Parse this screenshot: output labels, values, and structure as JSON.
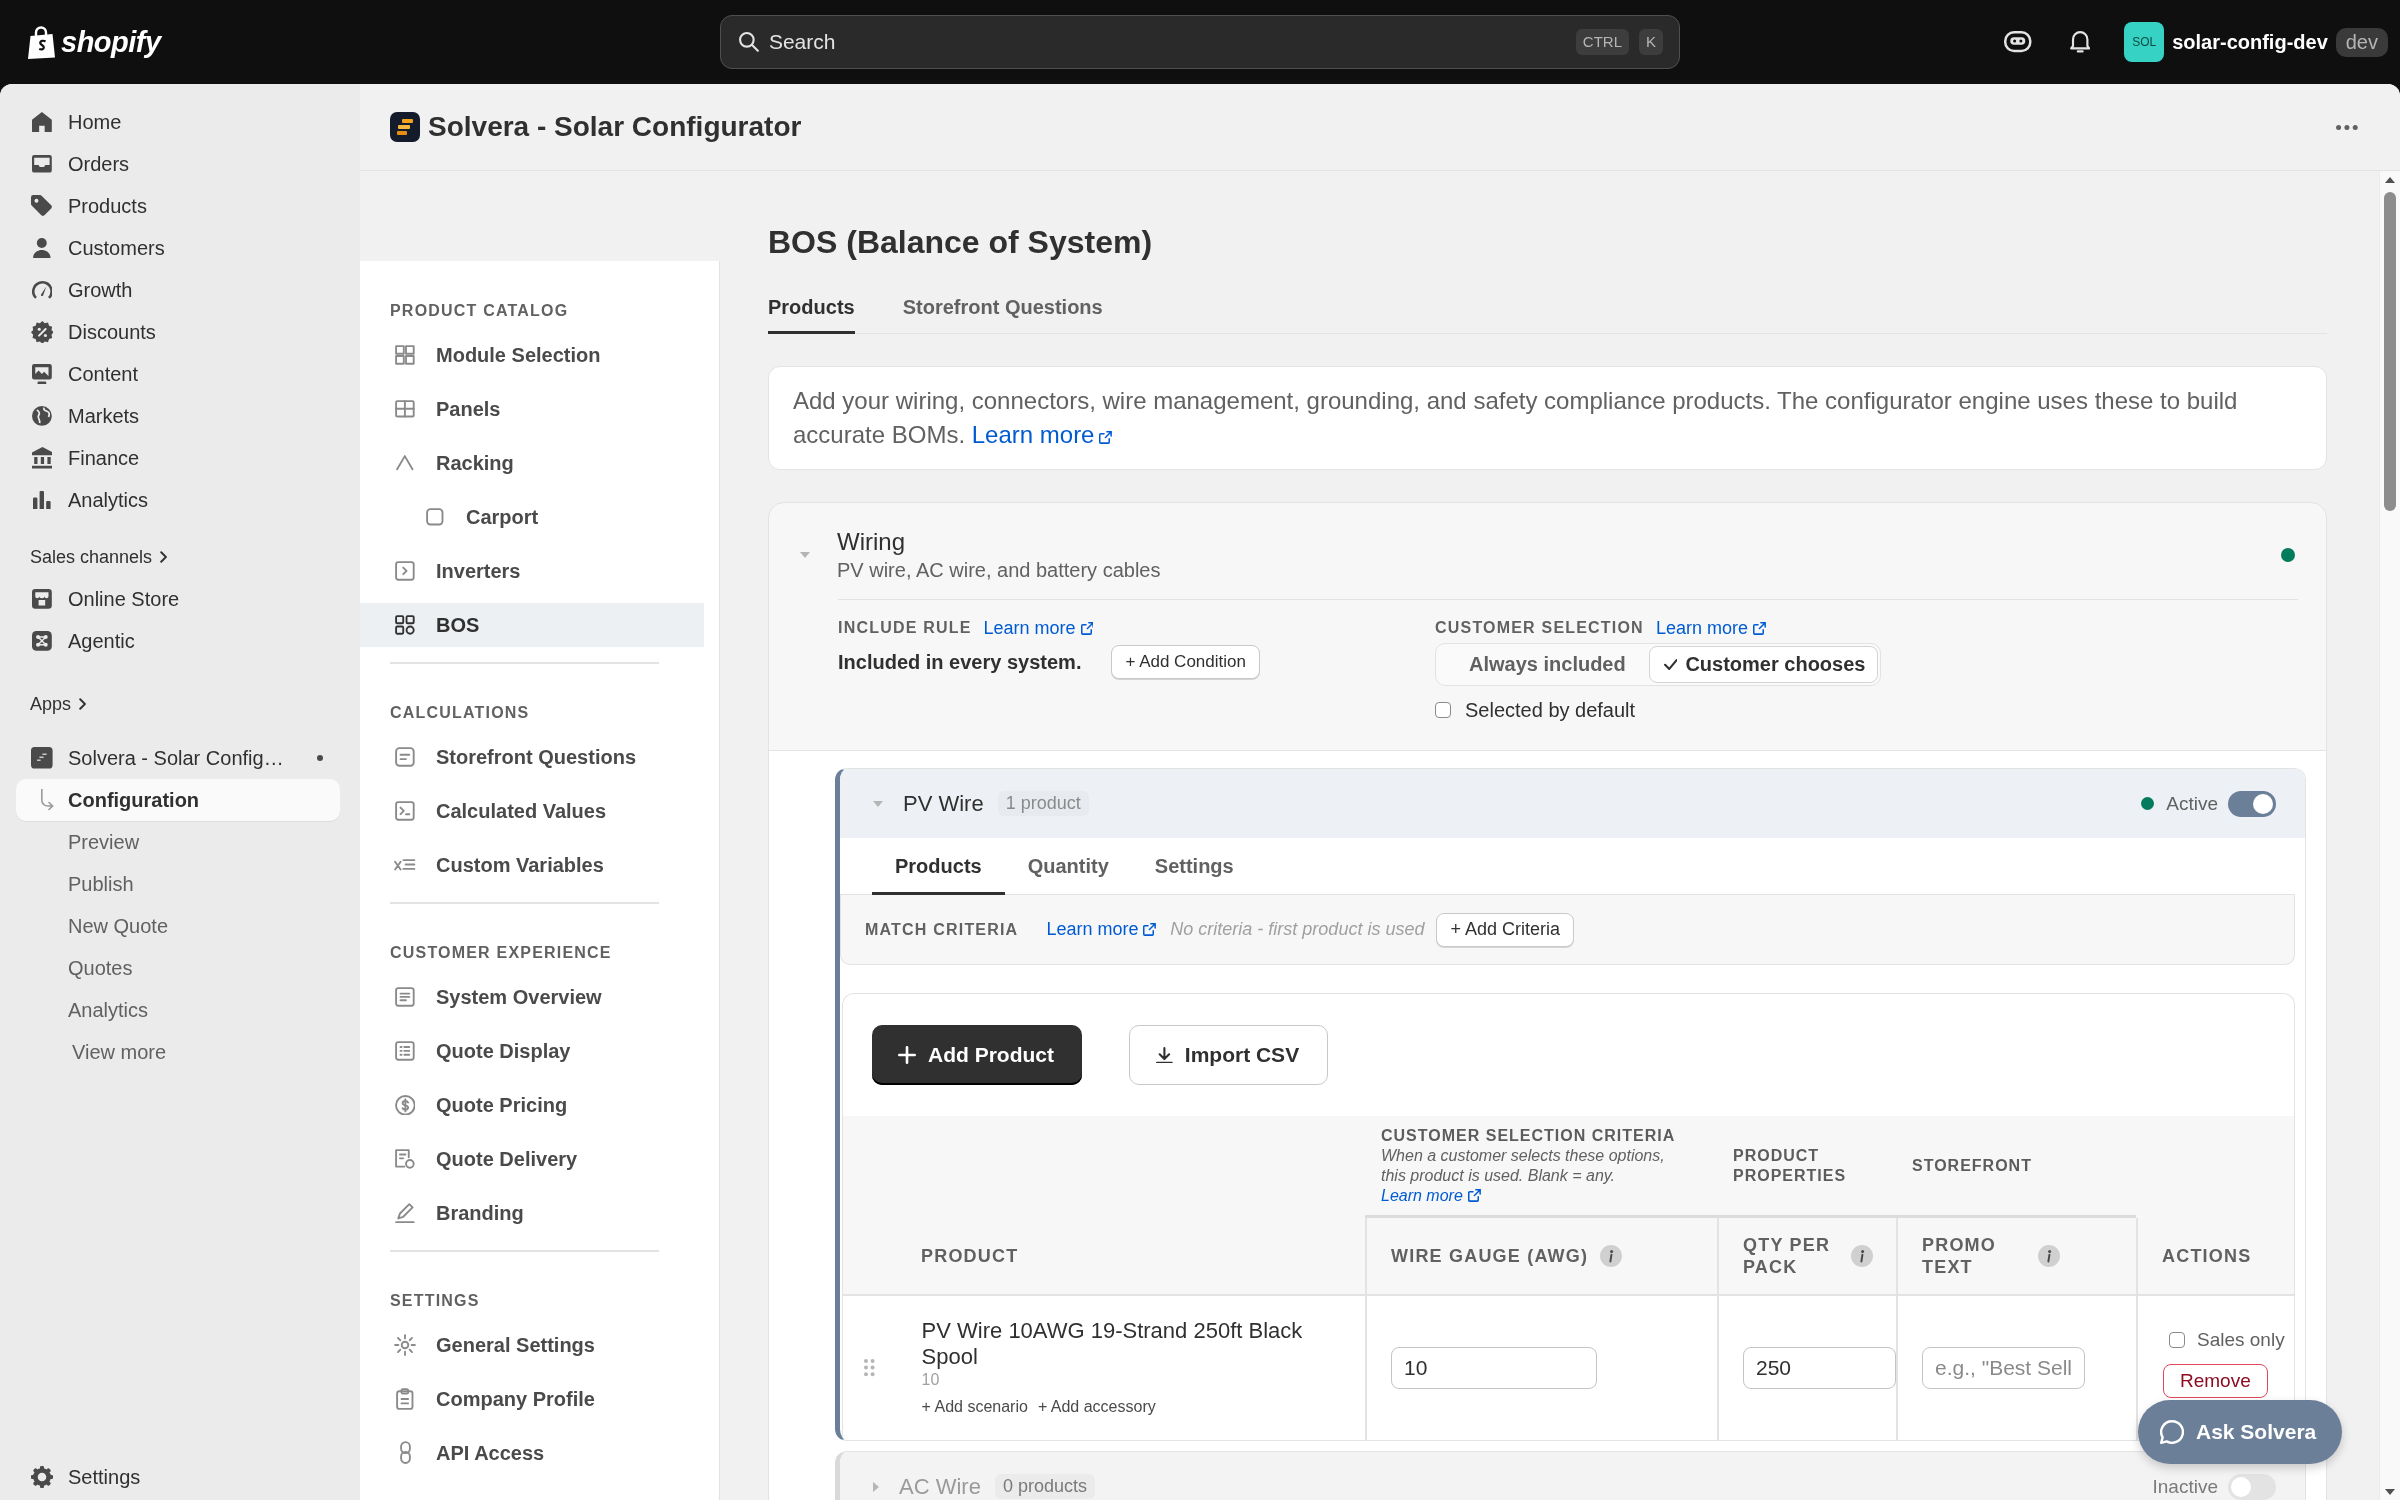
{
  "top_bar": {
    "logo": "shopify",
    "search": {
      "placeholder": "Search",
      "shortcut": [
        "CTRL",
        "K"
      ]
    },
    "store": {
      "avatar": "SOL",
      "name": "solar-config-dev",
      "badge": "dev"
    }
  },
  "sidebar": {
    "items": [
      {
        "label": "Home",
        "selected": false
      },
      {
        "label": "Orders",
        "selected": false
      },
      {
        "label": "Products",
        "selected": false
      },
      {
        "label": "Customers",
        "selected": false
      },
      {
        "label": "Growth",
        "selected": false
      },
      {
        "label": "Discounts",
        "selected": false
      },
      {
        "label": "Content",
        "selected": false
      },
      {
        "label": "Markets",
        "selected": false
      },
      {
        "label": "Finance",
        "selected": false
      },
      {
        "label": "Analytics",
        "selected": false
      }
    ],
    "sales_channels": {
      "heading": "Sales channels",
      "items": [
        {
          "label": "Online Store",
          "selected": false
        },
        {
          "label": "Agentic",
          "selected": false
        }
      ]
    },
    "apps": {
      "heading": "Apps",
      "app": {
        "label": "Solvera - Solar Config…",
        "selected": false
      },
      "subitems": [
        {
          "label": "Configuration",
          "selected": true
        },
        {
          "label": "Preview",
          "selected": false
        },
        {
          "label": "Publish",
          "selected": false
        },
        {
          "label": "New Quote",
          "selected": false
        },
        {
          "label": "Quotes",
          "selected": false
        },
        {
          "label": "Analytics",
          "selected": false
        }
      ],
      "view_more": "View more"
    },
    "settings": {
      "label": "Settings",
      "selected": false
    }
  },
  "app_header": {
    "title": "Solvera - Solar Configurator"
  },
  "app_nav": {
    "sections": [
      {
        "heading": "PRODUCT CATALOG",
        "items": [
          {
            "label": "Module Selection",
            "selected": false
          },
          {
            "label": "Panels",
            "selected": false
          },
          {
            "label": "Racking",
            "selected": false,
            "children": [
              {
                "label": "Carport",
                "selected": false
              }
            ]
          },
          {
            "label": "Inverters",
            "selected": false
          },
          {
            "label": "BOS",
            "selected": true
          }
        ]
      },
      {
        "heading": "CALCULATIONS",
        "items": [
          {
            "label": "Storefront Questions",
            "selected": false
          },
          {
            "label": "Calculated Values",
            "selected": false
          },
          {
            "label": "Custom Variables",
            "selected": false
          }
        ]
      },
      {
        "heading": "CUSTOMER EXPERIENCE",
        "items": [
          {
            "label": "System Overview",
            "selected": false
          },
          {
            "label": "Quote Display",
            "selected": false
          },
          {
            "label": "Quote Pricing",
            "selected": false
          },
          {
            "label": "Quote Delivery",
            "selected": false
          },
          {
            "label": "Branding",
            "selected": false
          }
        ]
      },
      {
        "heading": "SETTINGS",
        "items": [
          {
            "label": "General Settings",
            "selected": false
          },
          {
            "label": "Company Profile",
            "selected": false
          },
          {
            "label": "API Access",
            "selected": false
          }
        ]
      }
    ]
  },
  "page": {
    "title": "BOS (Balance of System)",
    "tabs": [
      {
        "label": "Products",
        "selected": true
      },
      {
        "label": "Storefront Questions",
        "selected": false
      }
    ],
    "intro": {
      "text": "Add your wiring, connectors, wire management, grounding, and safety compliance products. The configurator engine uses these to build accurate BOMs.",
      "link": "Learn more"
    },
    "categories": [
      {
        "title": "Wiring",
        "subtitle": "PV wire, AC wire, and battery cables",
        "expanded": true,
        "active": true,
        "include_rule": {
          "label": "INCLUDE RULE",
          "link": "Learn more",
          "text": "Included in every system.",
          "button": "+ Add Condition"
        },
        "customer_selection": {
          "label": "CUSTOMER SELECTION",
          "link": "Learn more",
          "options": [
            {
              "label": "Always included",
              "selected": false
            },
            {
              "label": "Customer chooses",
              "selected": true
            }
          ],
          "default_checkbox": {
            "label": "Selected by default",
            "checked": false
          }
        },
        "groups": [
          {
            "name": "PV Wire",
            "count": "1 product",
            "expanded": true,
            "active": true,
            "status": "Active",
            "tabs": [
              {
                "label": "Products",
                "selected": true
              },
              {
                "label": "Quantity",
                "selected": false
              },
              {
                "label": "Settings",
                "selected": false
              }
            ],
            "match_criteria": {
              "label": "MATCH CRITERIA",
              "link": "Learn more",
              "empty_text": "No criteria - first product is used",
              "button": "+ Add Criteria"
            },
            "buttons": [
              {
                "label": "Add Product",
                "kind": "primary"
              },
              {
                "label": "Import CSV",
                "kind": "secondary"
              }
            ],
            "table": {
              "column_groups": [
                {
                  "label": "CUSTOMER SELECTION CRITERIA",
                  "note": "When a customer selects these options, this product is used. Blank = any.",
                  "link": "Learn more"
                },
                {
                  "label": "PRODUCT PROPERTIES"
                },
                {
                  "label": "STOREFRONT"
                }
              ],
              "columns": [
                {
                  "label": "PRODUCT",
                  "info": false
                },
                {
                  "label": "WIRE GAUGE (AWG)",
                  "info": true
                },
                {
                  "label": "QTY PER PACK",
                  "info": true
                },
                {
                  "label": "PROMO TEXT",
                  "info": true
                },
                {
                  "label": "ACTIONS",
                  "info": false
                }
              ],
              "rows": [
                {
                  "product": "PV Wire 10AWG 19-Strand 250ft Black Spool",
                  "sku": "10",
                  "links": [
                    "+ Add scenario",
                    "+ Add accessory"
                  ],
                  "fields": [
                    {
                      "value": "10"
                    },
                    {
                      "value": "250"
                    },
                    {
                      "placeholder": "e.g., \"Best Sell"
                    }
                  ],
                  "sales_only": {
                    "label": "Sales only",
                    "checked": false
                  },
                  "remove": "Remove"
                }
              ]
            }
          },
          {
            "name": "AC Wire",
            "count": "0 products",
            "expanded": false,
            "active": false,
            "status": "Inactive"
          }
        ]
      }
    ]
  },
  "assistant_button": {
    "label": "Ask Solvera"
  }
}
